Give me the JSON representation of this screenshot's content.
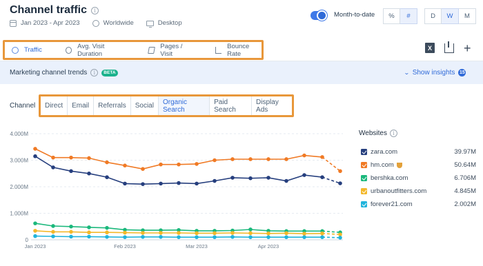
{
  "header": {
    "title": "Channel traffic",
    "date_range": "Jan 2023 - Apr 2023",
    "region": "Worldwide",
    "device": "Desktop",
    "toggle_label": "Month-to-date",
    "toggle_on": true,
    "unit_buttons": [
      "%",
      "#"
    ],
    "unit_active": "#",
    "granularity_buttons": [
      "D",
      "W",
      "M"
    ],
    "granularity_active": "W"
  },
  "metric_tabs": [
    {
      "label": "Traffic",
      "icon": "pie-chart-icon",
      "active": true
    },
    {
      "label": "Avg. Visit Duration",
      "icon": "clock-icon",
      "active": false
    },
    {
      "label": "Pages / Visit",
      "icon": "pages-icon",
      "active": false
    },
    {
      "label": "Bounce Rate",
      "icon": "bounce-icon",
      "active": false
    }
  ],
  "toolbar_icons": [
    "excel-export-icon",
    "download-icon",
    "add-icon"
  ],
  "trends": {
    "title": "Marketing channel trends",
    "beta": "BETA",
    "show_insights": "Show insights",
    "insights_count": "15"
  },
  "channel": {
    "label": "Channel",
    "options": [
      "Direct",
      "Email",
      "Referrals",
      "Social",
      "Organic Search",
      "Paid Search",
      "Display Ads"
    ],
    "active": "Organic Search"
  },
  "legend": {
    "title": "Websites",
    "items": [
      {
        "name": "zara.com",
        "value": "39.97M",
        "color": "#263f7e",
        "trophy": false
      },
      {
        "name": "hm.com",
        "value": "50.64M",
        "color": "#f07a25",
        "trophy": true
      },
      {
        "name": "bershka.com",
        "value": "6.706M",
        "color": "#1bb87c",
        "trophy": false
      },
      {
        "name": "urbanoutfitters.com",
        "value": "4.845M",
        "color": "#f3b82b",
        "trophy": false
      },
      {
        "name": "forever21.com",
        "value": "2.002M",
        "color": "#21b4dc",
        "trophy": false
      }
    ]
  },
  "chart_data": {
    "type": "line",
    "y_ticks": [
      "0",
      "1.000M",
      "2.000M",
      "3.000M",
      "4.000M"
    ],
    "ylim": [
      0,
      4000000
    ],
    "x_tick_labels": [
      "Jan 2023",
      "Feb 2023",
      "Mar 2023",
      "Apr 2023"
    ],
    "x_tick_index": [
      0,
      5,
      9,
      13
    ],
    "grid": true,
    "legend_position": "right",
    "num_points": 18,
    "dashed_last_segment": true,
    "series": [
      {
        "name": "hm.com",
        "color": "#f07a25",
        "values": [
          3430000,
          3100000,
          3100000,
          3080000,
          2920000,
          2800000,
          2670000,
          2840000,
          2840000,
          2860000,
          3000000,
          3040000,
          3040000,
          3040000,
          3040000,
          3180000,
          3120000,
          2590000
        ]
      },
      {
        "name": "zara.com",
        "color": "#263f7e",
        "values": [
          3150000,
          2730000,
          2590000,
          2500000,
          2360000,
          2120000,
          2100000,
          2120000,
          2140000,
          2120000,
          2220000,
          2340000,
          2320000,
          2340000,
          2220000,
          2440000,
          2360000,
          2130000
        ]
      },
      {
        "name": "bershka.com",
        "color": "#1bb87c",
        "values": [
          620000,
          520000,
          500000,
          470000,
          450000,
          380000,
          360000,
          360000,
          370000,
          340000,
          340000,
          350000,
          390000,
          340000,
          330000,
          330000,
          330000,
          280000
        ]
      },
      {
        "name": "urbanoutfitters.com",
        "color": "#f3b82b",
        "values": [
          340000,
          300000,
          300000,
          280000,
          280000,
          270000,
          260000,
          260000,
          260000,
          250000,
          250000,
          260000,
          250000,
          240000,
          250000,
          230000,
          240000,
          200000
        ]
      },
      {
        "name": "forever21.com",
        "color": "#21b4dc",
        "values": [
          140000,
          130000,
          120000,
          120000,
          110000,
          100000,
          110000,
          110000,
          100000,
          100000,
          100000,
          110000,
          100000,
          100000,
          100000,
          100000,
          100000,
          80000
        ]
      }
    ]
  }
}
